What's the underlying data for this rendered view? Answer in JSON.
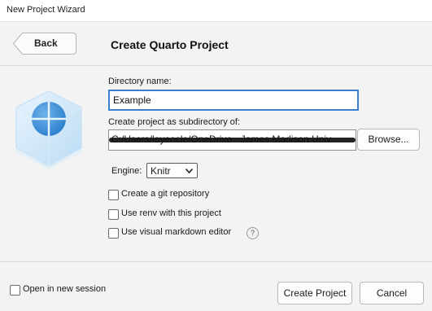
{
  "window": {
    "title": "New Project Wizard"
  },
  "header": {
    "back_label": "Back",
    "title": "Create Quarto Project"
  },
  "logo": {
    "icon": "quarto-cube-logo",
    "color": "#3d8fd6"
  },
  "form": {
    "directory_label": "Directory name:",
    "directory_value": "Example",
    "subdir_label": "Create project as subdirectory of:",
    "subdir_value": "C:/Users/layeocle/OneDrive - James Madison Univ",
    "browse_label": "Browse...",
    "engine_label": "Engine:",
    "engine_value": "Knitr",
    "options": [
      {
        "label": "Create a git repository",
        "checked": false
      },
      {
        "label": "Use renv with this project",
        "checked": false
      },
      {
        "label": "Use visual markdown editor",
        "checked": false
      }
    ],
    "help_glyph": "?"
  },
  "footer": {
    "open_session_label": "Open in new session",
    "open_session_checked": false,
    "create_label": "Create Project",
    "cancel_label": "Cancel"
  },
  "colors": {
    "focus_border": "#3a7fd0",
    "accent": "#3d8fd6"
  }
}
